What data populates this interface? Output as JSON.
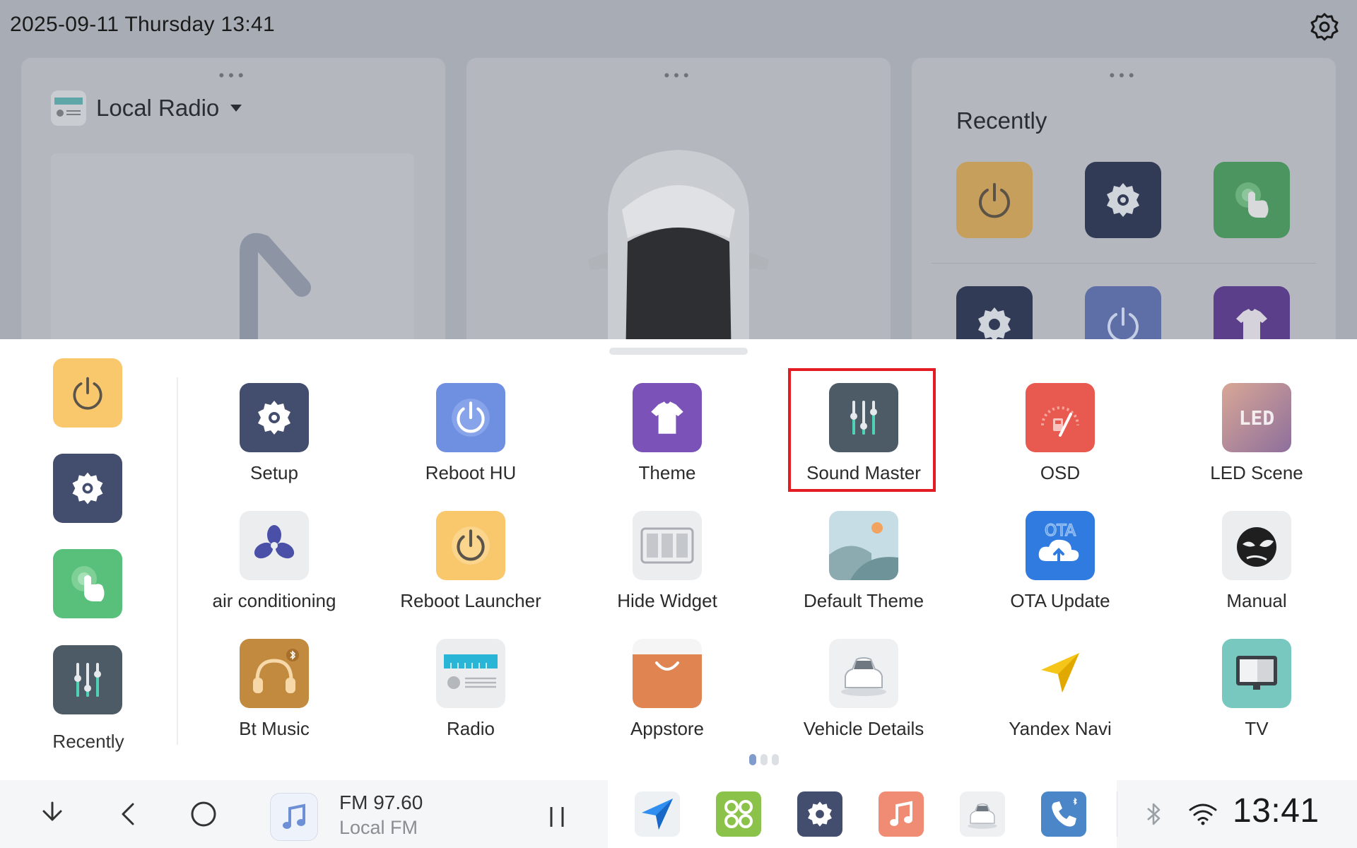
{
  "status": {
    "datetime": "2025-09-11 Thursday 13:41",
    "clock": "13:41"
  },
  "home": {
    "radio_card_title": "Local Radio",
    "recent_card_title": "Recently",
    "recent_apps": [
      "Reboot Launcher",
      "Setup",
      "Gesture",
      "Setup",
      "Reboot HU",
      "Theme"
    ]
  },
  "drawer": {
    "recent_label": "Recently",
    "recent_icons": [
      "power-icon",
      "gear-icon",
      "touch-icon",
      "equalizer-icon"
    ],
    "apps": [
      {
        "label": "Setup",
        "icon": "gear-icon"
      },
      {
        "label": "Reboot HU",
        "icon": "power-icon"
      },
      {
        "label": "Theme",
        "icon": "tshirt-icon"
      },
      {
        "label": "Sound Master",
        "icon": "equalizer-icon"
      },
      {
        "label": "OSD",
        "icon": "gauge-icon"
      },
      {
        "label": "LED Scene",
        "icon": "led-icon"
      },
      {
        "label": "air conditioning",
        "icon": "fan-icon"
      },
      {
        "label": "Reboot Launcher",
        "icon": "power-icon"
      },
      {
        "label": "Hide Widget",
        "icon": "widget-icon"
      },
      {
        "label": "Default Theme",
        "icon": "landscape-icon"
      },
      {
        "label": "OTA Update",
        "icon": "cloud-upload-icon"
      },
      {
        "label": "Manual",
        "icon": "manual-icon"
      },
      {
        "label": "Bt Music",
        "icon": "headphones-icon"
      },
      {
        "label": "Radio",
        "icon": "radio-icon"
      },
      {
        "label": "Appstore",
        "icon": "bag-icon"
      },
      {
        "label": "Vehicle Details",
        "icon": "car-icon"
      },
      {
        "label": "Yandex Navi",
        "icon": "navigation-arrow-icon"
      },
      {
        "label": "TV",
        "icon": "tv-icon"
      }
    ],
    "selected_app": "Sound Master",
    "page": {
      "current": 1,
      "total": 3
    }
  },
  "bottombar": {
    "now_playing": {
      "frequency": "FM 97.60",
      "station": "Local FM"
    },
    "dock_icons": [
      "navigation-icon",
      "apps-icon",
      "gear-icon",
      "music-icon",
      "car-icon",
      "phone-icon"
    ],
    "status_icons": [
      "bluetooth-icon",
      "wifi-icon"
    ]
  },
  "colors": {
    "highlight": "#e31b23",
    "page_dot_active": "#7f9ccc",
    "setup_tile": "#434d6d",
    "reboot_hu_tile": "#6f8fe0",
    "theme_tile": "#7a52b8",
    "sound_master_tile": "#4d5b66",
    "osd_tile": "#e85a4f",
    "reboot_launcher_tile": "#f9c86d",
    "yandex_navi": "#f5c519"
  }
}
